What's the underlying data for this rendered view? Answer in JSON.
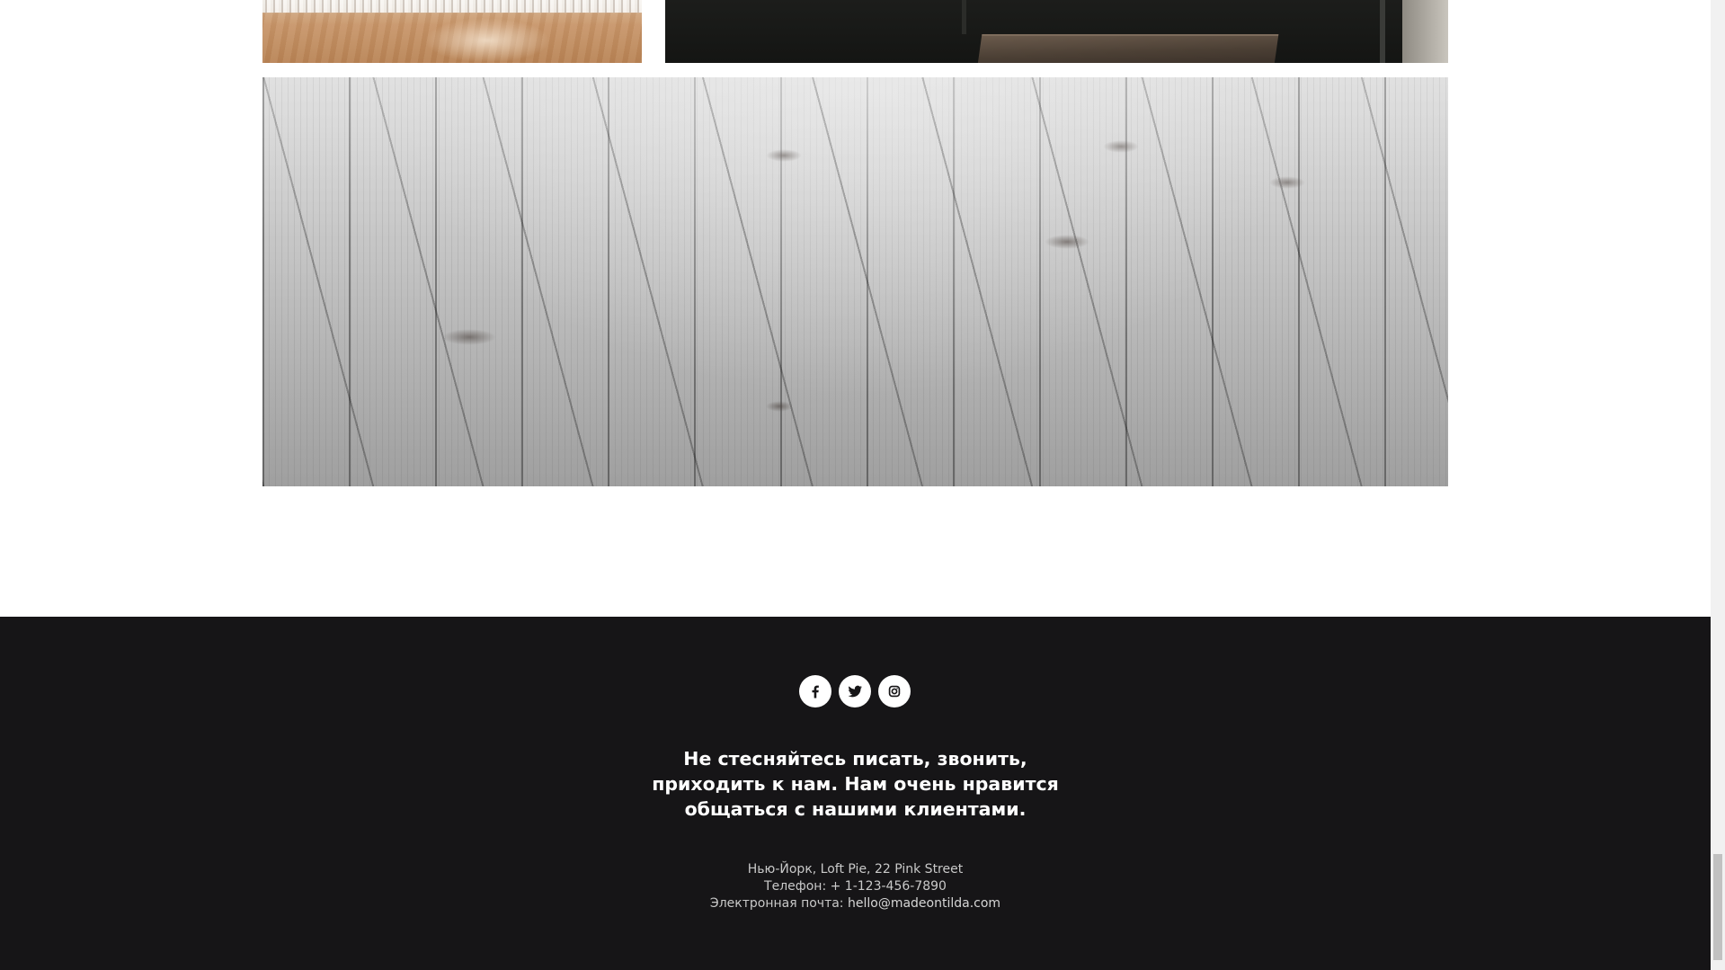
{
  "gallery": {
    "top_left_image_alt": "",
    "top_right_image_alt": "",
    "floor_image_alt": ""
  },
  "footer": {
    "social": [
      {
        "name": "facebook",
        "icon": "facebook-icon"
      },
      {
        "name": "twitter",
        "icon": "twitter-icon"
      },
      {
        "name": "instagram",
        "icon": "instagram-icon"
      }
    ],
    "tagline_line1": "Не стесняйтесь писать, звонить,",
    "tagline_line2": "приходить к нам. Нам очень нравится",
    "tagline_line3": "общаться с нашими клиентами.",
    "address": "Нью-Йорк, Loft Pie, 22 Pink Street",
    "phone": "Телефон: + 1-123-456-7890",
    "email_label": "Электронная почта: ",
    "email": "hello@madeontilda.com"
  },
  "colors": {
    "footer_bg": "#161517",
    "footer_text": "#ffffff",
    "footer_muted_text": "#c9c9c9"
  }
}
